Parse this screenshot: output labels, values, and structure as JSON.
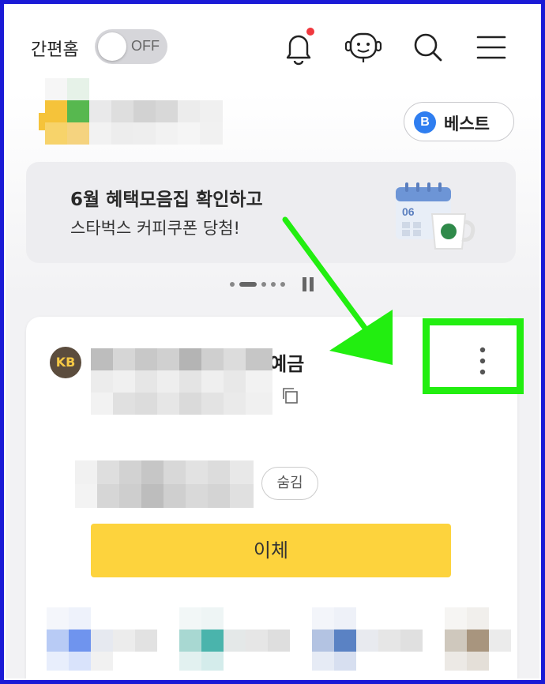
{
  "header": {
    "simple_home_label": "간편홈",
    "toggle_text": "OFF",
    "has_notification": true
  },
  "best_button": {
    "badge": "B",
    "label": "베스트"
  },
  "banner": {
    "line1": "6월 혜택모음집 확인하고",
    "line2": "스타벅스 커피쿠폰 당첨!",
    "calendar_date": "06"
  },
  "account_card": {
    "bank_logo_text": "KB",
    "account_name_suffix": "통예금",
    "hide_label": "숨김",
    "transfer_label": "이체"
  },
  "colors": {
    "highlight": "#22ee10",
    "transfer_button": "#fdd33d",
    "border": "#1a1ad6"
  }
}
